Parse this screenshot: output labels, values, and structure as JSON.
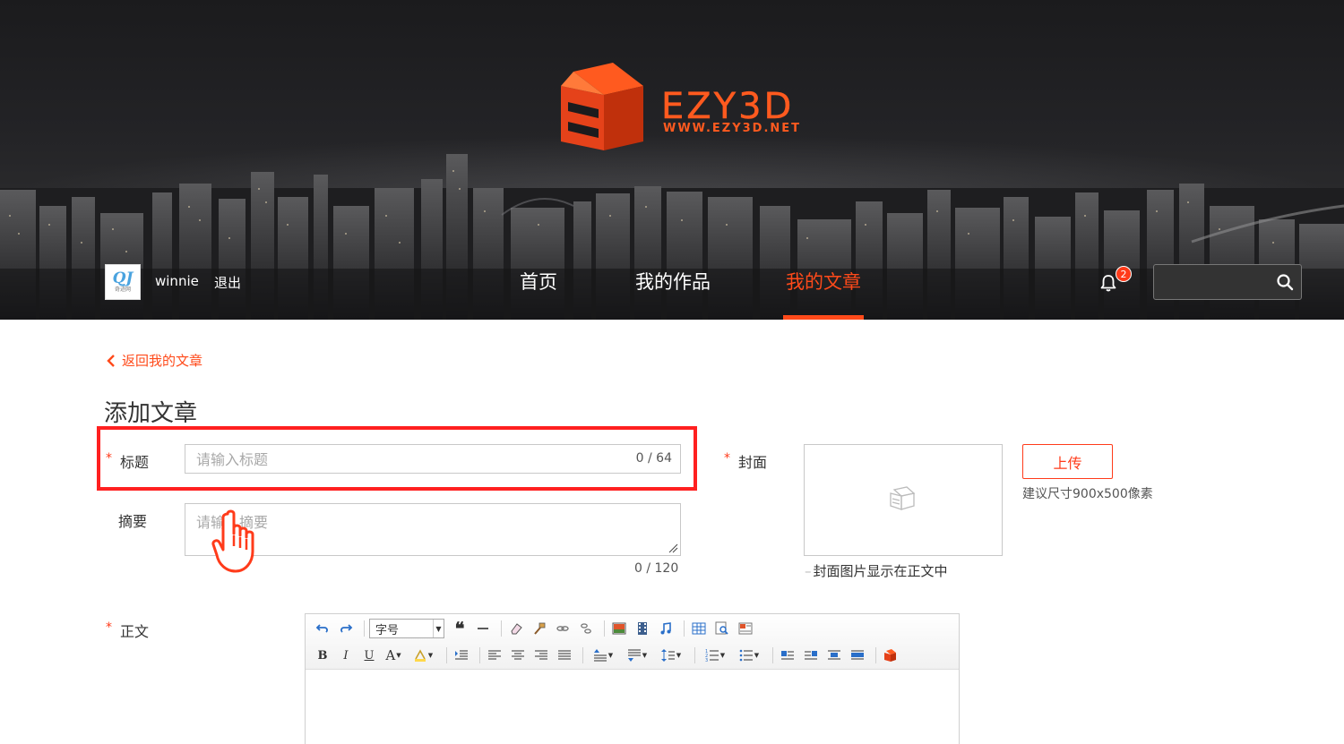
{
  "brand": {
    "name": "EZY3D",
    "url": "WWW.EZY3D.NET",
    "accent_color": "#ff4a1a"
  },
  "user": {
    "avatar_text": "QJ",
    "avatar_subtext": "奇迹网",
    "name": "winnie",
    "logout_label": "退出"
  },
  "nav": {
    "items": [
      {
        "label": "首页",
        "active": false
      },
      {
        "label": "我的作品",
        "active": false
      },
      {
        "label": "我的文章",
        "active": true
      }
    ]
  },
  "notifications": {
    "icon": "bell-icon",
    "count": "2"
  },
  "search": {
    "placeholder": "",
    "icon": "search-icon"
  },
  "page": {
    "back_label": "返回我的文章",
    "title": "添加文章"
  },
  "form": {
    "title_label": "标题",
    "title_placeholder": "请输入标题",
    "title_counter": "0 / 64",
    "summary_label": "摘要",
    "summary_placeholder": "请输入摘要",
    "summary_counter": "0 / 120",
    "cover_label": "封面",
    "cover_note": "封面图片显示在正文中",
    "upload_label": "上传",
    "upload_hint": "建议尺寸900x500像素",
    "body_label": "正文",
    "required_mark": "*"
  },
  "editor": {
    "font_size_select": "字号",
    "row1_icons": [
      "undo-icon",
      "redo-icon",
      "font-size-select",
      "blockquote-icon",
      "horizontal-rule-icon",
      "eraser-icon",
      "format-painter-icon",
      "link-icon",
      "unlink-icon",
      "image-icon",
      "video-icon",
      "music-icon",
      "table-icon",
      "search-replace-icon",
      "template-icon"
    ],
    "row2_icons": [
      "bold-icon",
      "italic-icon",
      "underline-icon",
      "font-color-icon",
      "background-color-icon",
      "indent-icon",
      "align-left-icon",
      "align-center-icon",
      "align-right-icon",
      "align-justify-icon",
      "row-spacing-top-icon",
      "row-spacing-bottom-icon",
      "line-height-icon",
      "ordered-list-icon",
      "unordered-list-icon",
      "image-left-icon",
      "image-right-icon",
      "image-center-icon",
      "image-none-icon",
      "ezy3d-model-icon"
    ],
    "bold": "B",
    "italic": "I",
    "underline": "U",
    "font_color": "A"
  }
}
